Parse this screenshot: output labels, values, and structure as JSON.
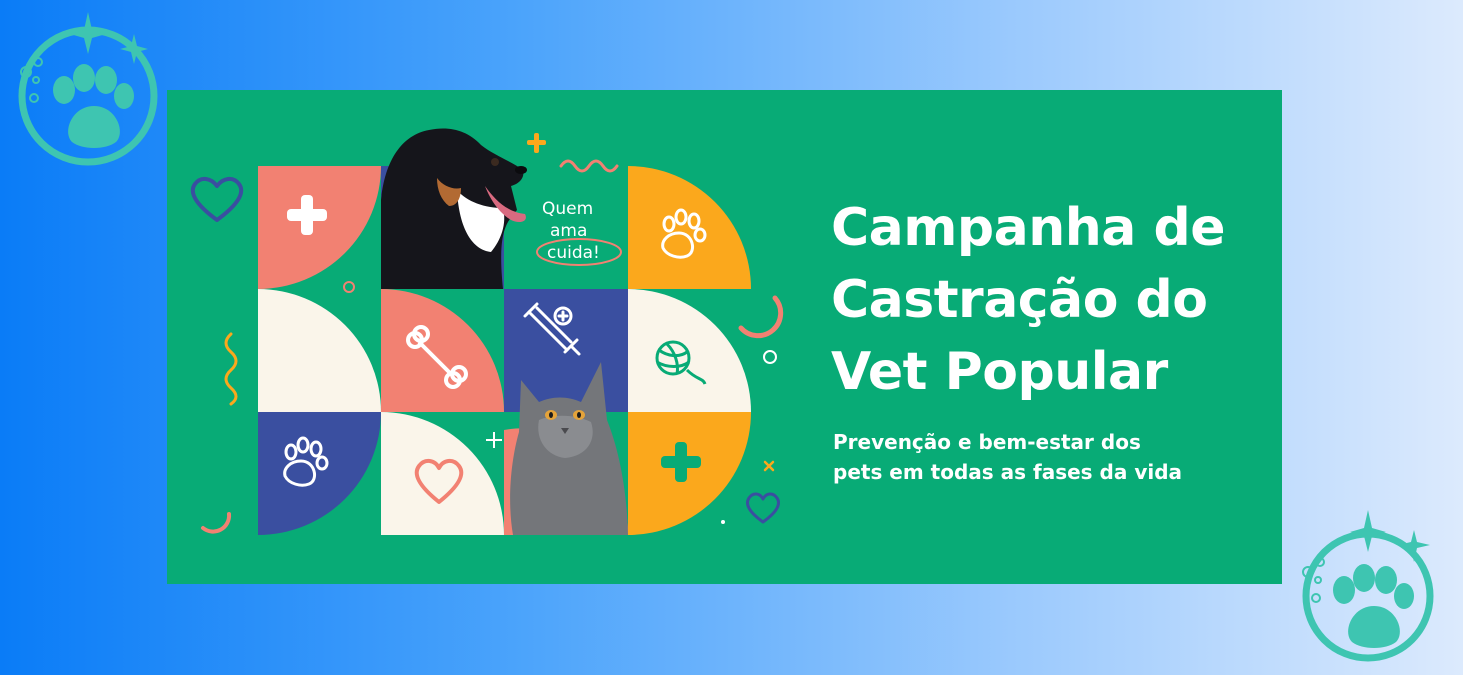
{
  "banner": {
    "title_lines": [
      "Campanha de",
      "Castração do",
      "Vet Popular"
    ],
    "subtitle_lines": [
      "Prevenção e bem-estar dos",
      "pets em todas as fases da vida"
    ],
    "slogan_lines": [
      "Quem",
      "ama",
      "cuida!"
    ]
  },
  "colors": {
    "banner_green": "#08ab76",
    "coral": "#f28172",
    "orange": "#fba81c",
    "navy": "#3a4fa0",
    "cream": "#faf5ea",
    "logo_teal": "#3ec5b1"
  },
  "icons": [
    "paw-logo-icon",
    "plus-icon",
    "paw-icon",
    "bone-icon",
    "syringe-icon",
    "yarn-ball-icon",
    "heart-icon"
  ]
}
